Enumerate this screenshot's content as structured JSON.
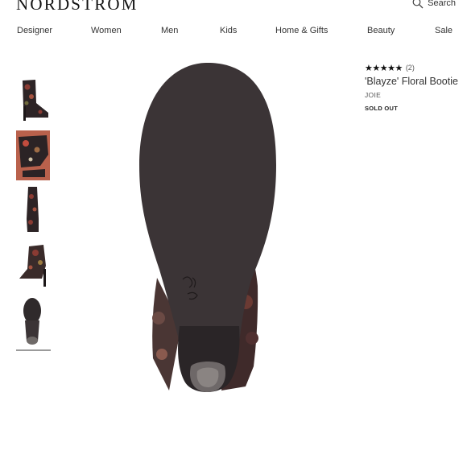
{
  "header": {
    "logo": "NORDSTROM",
    "search_label": "Search"
  },
  "nav": {
    "items": [
      "Designer",
      "Women",
      "Men",
      "Kids",
      "Home & Gifts",
      "Beauty",
      "Sale"
    ]
  },
  "gallery": {
    "thumbnails": [
      {
        "label": "side view"
      },
      {
        "label": "detail view"
      },
      {
        "label": "front view"
      },
      {
        "label": "angle view"
      },
      {
        "label": "sole view"
      }
    ],
    "selected_index": 4
  },
  "product": {
    "stars": "★★★★★",
    "review_count": "(2)",
    "title": "'Blayze' Floral Bootie",
    "brand": "JOIE",
    "status": "SOLD OUT"
  },
  "colors": {
    "sole": "#3b3436",
    "heel": "#2a2527",
    "floral": "#5a2e2a"
  }
}
